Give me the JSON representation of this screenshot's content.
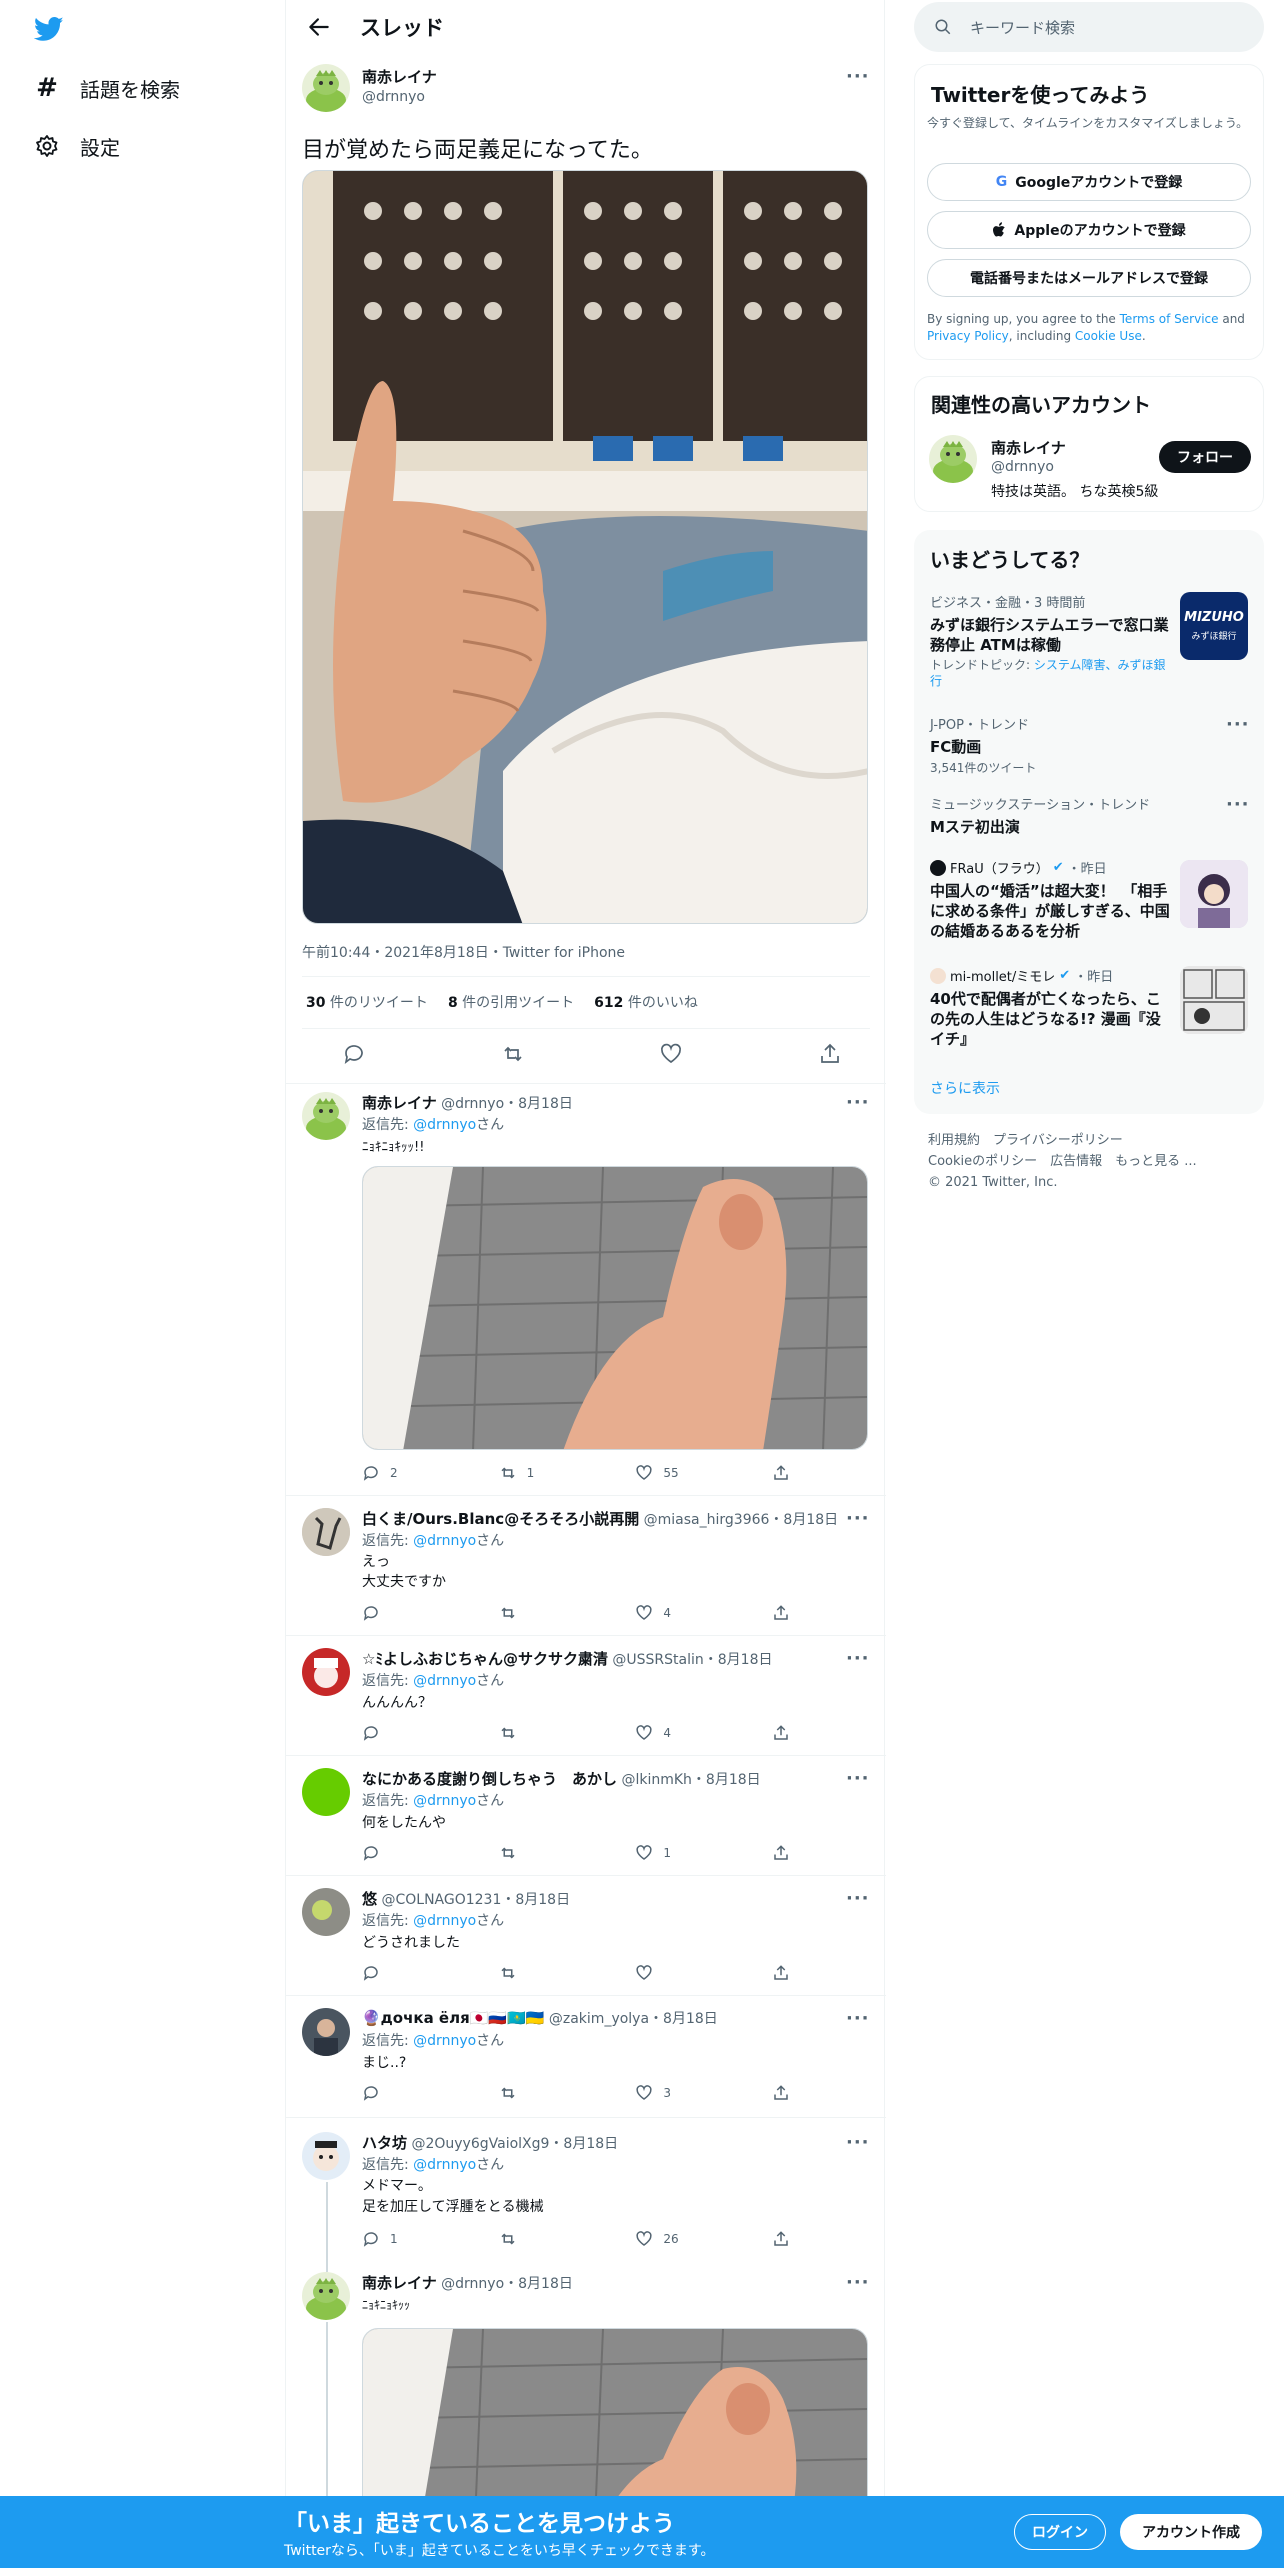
{
  "nav": {
    "explore": "話題を検索",
    "settings": "設定"
  },
  "header": {
    "title": "スレッド"
  },
  "main_tweet": {
    "name": "南赤レイナ",
    "handle": "@drnnyo",
    "text": "目が覚めたら両足義足になってた。",
    "meta": "午前10:44・2021年8月18日・Twitter for iPhone",
    "retweets_num": "30",
    "retweets_label": " 件のリツイート",
    "quotes_num": "8",
    "quotes_label": " 件の引用ツイート",
    "likes_num": "612",
    "likes_label": " 件のいいね"
  },
  "replies": [
    {
      "name": "南赤レイナ",
      "handle": "@drnnyo・8月18日",
      "reply_to_prefix": "返信先: ",
      "reply_to": "@drnnyo",
      "reply_to_suffix": "さん",
      "text": "ﾆｮｷﾆｮｷｯｯ!!",
      "replies": "2",
      "retweets": "1",
      "likes": "55"
    },
    {
      "name": "白くま/Ours.Blanc@そろそろ小説再開",
      "handle": "@miasa_hirg3966・8月18日",
      "reply_to_prefix": "返信先: ",
      "reply_to": "@drnnyo",
      "reply_to_suffix": "さん",
      "text": "えっ\n大丈夫ですか",
      "replies": "",
      "retweets": "",
      "likes": "4"
    },
    {
      "name": "☆ﾐよしふおじちゃん@サクサク粛清",
      "handle": "@USSRStalin・8月18日",
      "reply_to_prefix": "返信先: ",
      "reply_to": "@drnnyo",
      "reply_to_suffix": "さん",
      "text": "んんんん？",
      "replies": "",
      "retweets": "",
      "likes": "4"
    },
    {
      "name": "なにかある度謝り倒しちゃう　あかし",
      "handle": "@lkinmKh・8月18日",
      "reply_to_prefix": "返信先: ",
      "reply_to": "@drnnyo",
      "reply_to_suffix": "さん",
      "text": "何をしたんや",
      "replies": "",
      "retweets": "",
      "likes": "1"
    },
    {
      "name": "悠",
      "handle": "@COLNAGO1231・8月18日",
      "reply_to_prefix": "返信先: ",
      "reply_to": "@drnnyo",
      "reply_to_suffix": "さん",
      "text": "どうされました",
      "replies": "",
      "retweets": "",
      "likes": ""
    },
    {
      "name": "🔮дочка ёля🇯🇵🇷🇺🇰🇿🇺🇦",
      "handle": "@zakim_yolya・8月18日",
      "reply_to_prefix": "返信先: ",
      "reply_to": "@drnnyo",
      "reply_to_suffix": "さん",
      "text": "まじ..?",
      "replies": "",
      "retweets": "",
      "likes": "3"
    },
    {
      "name": "ハタ坊",
      "handle": "@2Ouyy6gVaiolXg9・8月18日",
      "reply_to_prefix": "返信先: ",
      "reply_to": "@drnnyo",
      "reply_to_suffix": "さん",
      "text": "メドマー。\n足を加圧して浮腫をとる機械",
      "replies": "1",
      "retweets": "",
      "likes": "26"
    },
    {
      "name": "南赤レイナ",
      "handle": "@drnnyo・8月18日",
      "text": "ﾆｮｷﾆｮｷｯｯ"
    }
  ],
  "search": {
    "placeholder": "キーワード検索"
  },
  "signup": {
    "title": "Twitterを使ってみよう",
    "subtitle": "今すぐ登録して、タイムラインをカスタマイズしましょう。",
    "google": "Googleアカウントで登録",
    "apple": "Appleのアカウントで登録",
    "phone": "電話番号またはメールアドレスで登録",
    "terms_a": "By signing up, you agree to the ",
    "terms_link1": "Terms of Service",
    "terms_b": " and ",
    "terms_link2": "Privacy Policy",
    "terms_c": ", including ",
    "terms_link3": "Cookie Use",
    "terms_d": "."
  },
  "related": {
    "title": "関連性の高いアカウント",
    "name": "南赤レイナ",
    "handle": "@drnnyo",
    "bio": "特技は英語。 ちな英検5級",
    "follow": "フォロー"
  },
  "trends": {
    "title": "いまどうしてる？",
    "items": [
      {
        "meta": "ビジネス・金融・3 時間前",
        "name": "みずほ銀行システムエラーで窓口業務停止 ATMは稼働",
        "extra_prefix": "トレンドトピック: ",
        "extra_link": "システム障害、みずほ銀行"
      },
      {
        "meta": "J-POP・トレンド",
        "name": "FC動画",
        "count": "3,541件のツイート"
      },
      {
        "meta": "ミュージックステーション・トレンド",
        "name": "Mステ初出演"
      },
      {
        "source": "FRaU（フラウ）",
        "time": "・昨日",
        "name": "中国人の“婚活”は超大変！　「相手に求める条件」が厳しすぎる、中国の結婚あるあるを分析"
      },
      {
        "source": "mi-mollet/ミモレ",
        "time": "・昨日",
        "name": "40代で配偶者が亡くなったら、この先の人生はどうなる!? 漫画『没イチ』"
      }
    ],
    "more": "さらに表示",
    "mizuho_logo": "MIZUHO",
    "mizuho_sub": "みずほ銀行"
  },
  "footer": {
    "line1": "利用規約　プライバシーポリシー",
    "line2": "Cookieのポリシー　広告情報　もっと見る ...",
    "line3": "© 2021 Twitter, Inc."
  },
  "bottom": {
    "title": "「いま」起きていることを見つけよう",
    "subtitle": "Twitterなら、「いま」起きていることをいち早くチェックできます。",
    "login": "ログイン",
    "signup": "アカウント作成"
  },
  "colors": {
    "accent": "#1d9bf0",
    "text": "#0f1419",
    "muted": "#536471"
  }
}
